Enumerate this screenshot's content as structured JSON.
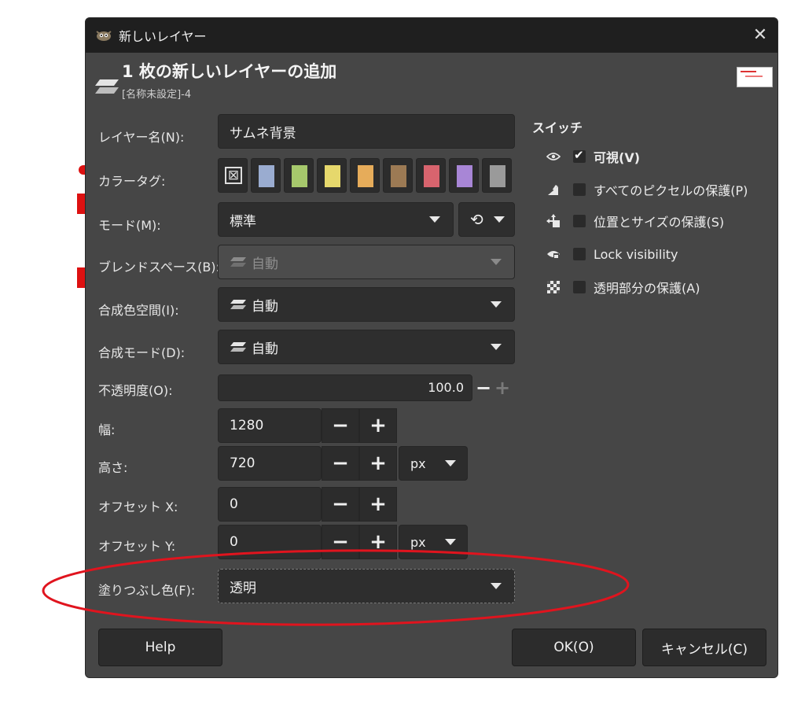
{
  "window": {
    "title": "新しいレイヤー"
  },
  "header": {
    "title": "1 枚の新しいレイヤーの追加",
    "subtitle": "[名称未設定]-4"
  },
  "form": {
    "layer_name": {
      "label": "レイヤー名(N):",
      "value": "サムネ背景"
    },
    "color_tag": {
      "label": "カラータグ:",
      "swatches": [
        "none",
        "#9aacd0",
        "#a6c86c",
        "#e6d86c",
        "#e6ac5a",
        "#9c7a54",
        "#d8646e",
        "#a886d6",
        "#9a9a9a"
      ]
    },
    "mode": {
      "label": "モード(M):",
      "value": "標準"
    },
    "blend_space": {
      "label": "ブレンドスペース(B):",
      "value": "自動"
    },
    "composite_space": {
      "label": "合成色空間(I):",
      "value": "自動"
    },
    "composite_mode": {
      "label": "合成モード(D):",
      "value": "自動"
    },
    "opacity": {
      "label": "不透明度(O):",
      "value": "100.0"
    },
    "width": {
      "label": "幅:",
      "value": "1280"
    },
    "height": {
      "label": "高さ:",
      "value": "720",
      "unit": "px"
    },
    "offset_x": {
      "label": "オフセット X:",
      "value": "0"
    },
    "offset_y": {
      "label": "オフセット Y:",
      "value": "0",
      "unit": "px"
    },
    "fill": {
      "label": "塗りつぶし色(F):",
      "value": "透明"
    }
  },
  "switches": {
    "title": "スイッチ",
    "items": [
      {
        "icon": "eye-icon",
        "label": "可視(V)",
        "checked": true
      },
      {
        "icon": "paintbrush-icon",
        "label": "すべてのピクセルの保護(P)",
        "checked": false
      },
      {
        "icon": "move-icon",
        "label": "位置とサイズの保護(S)",
        "checked": false
      },
      {
        "icon": "visibility-lock-icon",
        "label": "Lock visibility",
        "checked": false
      },
      {
        "icon": "checkerboard-icon",
        "label": "透明部分の保護(A)",
        "checked": false
      }
    ]
  },
  "buttons": {
    "help": "Help",
    "ok": "OK(O)",
    "cancel": "キャンセル(C)"
  },
  "colors": {
    "annotation": "#e0141e",
    "dialog_bg": "#464646",
    "titlebar_bg": "#1f1f1f"
  }
}
